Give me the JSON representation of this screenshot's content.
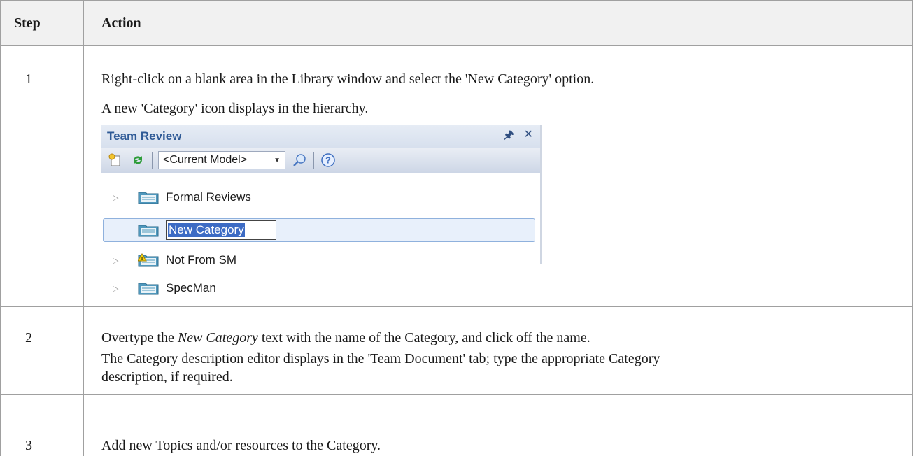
{
  "table": {
    "headers": {
      "step": "Step",
      "action": "Action"
    },
    "rows": [
      {
        "step": "1",
        "lines": [
          "Right-click on a blank area in the Library window and select the 'New Category' option.",
          "A new 'Category' icon displays in the hierarchy."
        ]
      },
      {
        "step": "2",
        "line1_em": "New Category",
        "line1_pre": "Overtype the ",
        "line1_post": " text with the name of the Category, and click off the name.",
        "line2": "The Category description editor displays in the 'Team Document' tab; type the appropriate Category",
        "line3": "description, if required."
      },
      {
        "step": "3",
        "lines": [
          "Add new Topics and/or resources to the Category."
        ]
      }
    ]
  },
  "team_review": {
    "title": "Team Review",
    "pin_icon": "pin-icon",
    "close_icon": "close-icon",
    "model_select": "<Current Model>",
    "tree": [
      {
        "label": "Formal Reviews",
        "icon": "folder-icon",
        "expandable": true
      },
      {
        "label": "New Category",
        "icon": "folder-icon",
        "expandable": false,
        "editing": true
      },
      {
        "label": "Not From SM",
        "icon": "folder-warning-icon",
        "expandable": true
      },
      {
        "label": "SpecMan",
        "icon": "folder-icon",
        "expandable": true
      }
    ]
  },
  "colors": {
    "border": "#a0a0a0",
    "header_bg": "#f1f1f1",
    "accent": "#2f5a96"
  }
}
